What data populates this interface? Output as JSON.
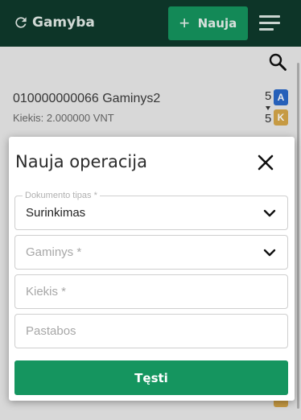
{
  "app": {
    "brand": "Gamyba",
    "add_button_label": "Nauja"
  },
  "list": {
    "item": {
      "title": "010000000066 Gaminys2",
      "subtitle": "Kiekis: 2.000000 VNT",
      "qty_top": "5",
      "qty_bottom": "5",
      "badge_top": "A",
      "badge_bottom": "K"
    }
  },
  "modal": {
    "title": "Nauja operacija",
    "document_type": {
      "label": "Dokumento tipas *",
      "value": "Surinkimas"
    },
    "product": {
      "placeholder": "Gaminys *"
    },
    "quantity": {
      "placeholder": "Kiekis *"
    },
    "notes": {
      "placeholder": "Pastabos"
    },
    "submit_label": "Tęsti"
  },
  "colors": {
    "header_bg": "#0f3a2c",
    "accent_green": "#15955f",
    "badge_blue": "#2a69c9",
    "badge_gold": "#d7a849"
  },
  "icons": [
    "refresh-icon",
    "plus-icon",
    "menu-icon",
    "search-icon",
    "close-icon",
    "chevron-down-icon"
  ]
}
